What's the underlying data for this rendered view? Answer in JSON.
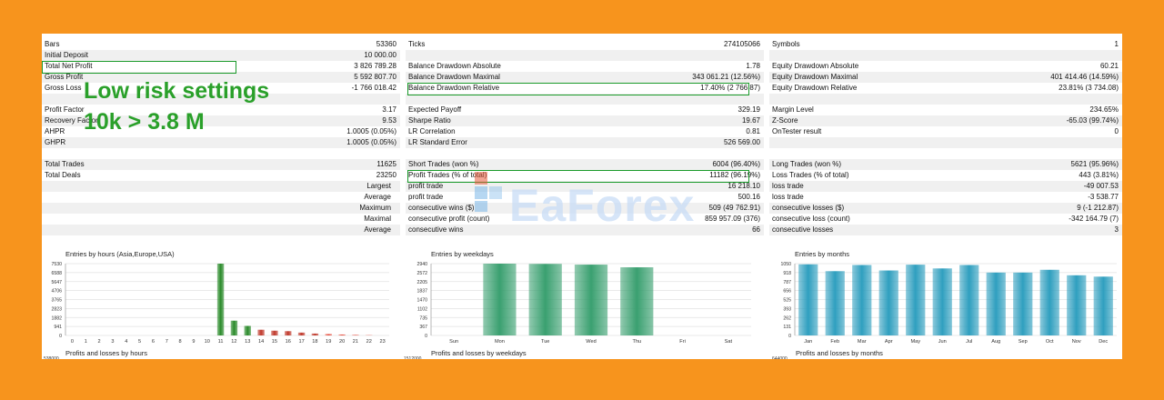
{
  "overlay": {
    "line1": "Low risk settings",
    "line2": "10k > 3.8 M"
  },
  "watermark": "EaForex",
  "col1": [
    {
      "label": "Bars",
      "value": "53360"
    },
    {
      "label": "Initial Deposit",
      "value": "10 000.00"
    },
    {
      "label": "Total Net Profit",
      "value": "3 826 789.28"
    },
    {
      "label": "Gross Profit",
      "value": "5 592 807.70"
    },
    {
      "label": "Gross Loss",
      "value": "-1 766 018.42"
    },
    {
      "label": "",
      "value": ""
    },
    {
      "label": "Profit Factor",
      "value": "3.17"
    },
    {
      "label": "Recovery Factor",
      "value": "9.53"
    },
    {
      "label": "AHPR",
      "value": "1.0005 (0.05%)"
    },
    {
      "label": "GHPR",
      "value": "1.0005 (0.05%)"
    },
    {
      "label": "",
      "value": ""
    },
    {
      "label": "Total Trades",
      "value": "11625"
    },
    {
      "label": "Total Deals",
      "value": "23250"
    },
    {
      "label": "Largest",
      "value": "",
      "right": true
    },
    {
      "label": "Average",
      "value": "",
      "right": true
    },
    {
      "label": "Maximum",
      "value": "",
      "right": true
    },
    {
      "label": "Maximal",
      "value": "",
      "right": true
    },
    {
      "label": "Average",
      "value": "",
      "right": true
    }
  ],
  "col2": [
    {
      "label": "Ticks",
      "value": "274105066"
    },
    {
      "label": "",
      "value": ""
    },
    {
      "label": "Balance Drawdown Absolute",
      "value": "1.78"
    },
    {
      "label": "Balance Drawdown Maximal",
      "value": "343 061.21 (12.56%)"
    },
    {
      "label": "Balance Drawdown Relative",
      "value": "17.40% (2 766.87)"
    },
    {
      "label": "",
      "value": ""
    },
    {
      "label": "Expected Payoff",
      "value": "329.19"
    },
    {
      "label": "Sharpe Ratio",
      "value": "19.67"
    },
    {
      "label": "LR Correlation",
      "value": "0.81"
    },
    {
      "label": "LR Standard Error",
      "value": "526 569.00"
    },
    {
      "label": "",
      "value": ""
    },
    {
      "label": "Short Trades (won %)",
      "value": "6004 (96.40%)"
    },
    {
      "label": "Profit Trades (% of total)",
      "value": "11182 (96.19%)"
    },
    {
      "label": "profit trade",
      "value": "16 218.10"
    },
    {
      "label": "profit trade",
      "value": "500.16"
    },
    {
      "label": "consecutive wins ($)",
      "value": "509 (49 762.91)"
    },
    {
      "label": "consecutive profit (count)",
      "value": "859 957.09 (376)"
    },
    {
      "label": "consecutive wins",
      "value": "66"
    }
  ],
  "col3": [
    {
      "label": "Symbols",
      "value": "1"
    },
    {
      "label": "",
      "value": ""
    },
    {
      "label": "Equity Drawdown Absolute",
      "value": "60.21"
    },
    {
      "label": "Equity Drawdown Maximal",
      "value": "401 414.46 (14.59%)"
    },
    {
      "label": "Equity Drawdown Relative",
      "value": "23.81% (3 734.08)"
    },
    {
      "label": "",
      "value": ""
    },
    {
      "label": "Margin Level",
      "value": "234.65%"
    },
    {
      "label": "Z-Score",
      "value": "-65.03 (99.74%)"
    },
    {
      "label": "OnTester result",
      "value": "0"
    },
    {
      "label": "",
      "value": ""
    },
    {
      "label": "",
      "value": ""
    },
    {
      "label": "Long Trades (won %)",
      "value": "5621 (95.96%)"
    },
    {
      "label": "Loss Trades (% of total)",
      "value": "443 (3.81%)"
    },
    {
      "label": "loss trade",
      "value": "-49 007.53"
    },
    {
      "label": "loss trade",
      "value": "-3 538.77"
    },
    {
      "label": "consecutive losses ($)",
      "value": "9 (-1 212.87)"
    },
    {
      "label": "consecutive loss (count)",
      "value": "-342 164.79 (7)"
    },
    {
      "label": "consecutive losses",
      "value": "3"
    }
  ],
  "chart_data": [
    {
      "type": "bar",
      "title": "Entries by hours (Asia,Europe,USA)",
      "categories": [
        "0",
        "1",
        "2",
        "3",
        "4",
        "5",
        "6",
        "7",
        "8",
        "9",
        "10",
        "11",
        "12",
        "13",
        "14",
        "15",
        "16",
        "17",
        "18",
        "19",
        "20",
        "21",
        "22",
        "23"
      ],
      "values": [
        0,
        0,
        0,
        0,
        0,
        0,
        0,
        0,
        0,
        0,
        0,
        7530,
        1550,
        1000,
        600,
        500,
        450,
        300,
        200,
        150,
        100,
        60,
        30,
        0
      ],
      "yticks": [
        "7530",
        "6588",
        "5647",
        "4706",
        "3765",
        "2823",
        "1882",
        "941",
        "0"
      ],
      "ylim": [
        0,
        7530
      ],
      "color": "#2a8a2a"
    },
    {
      "type": "bar",
      "title": "Entries by weekdays",
      "categories": [
        "Sun",
        "Mon",
        "Tue",
        "Wed",
        "Thu",
        "Fri",
        "Sat"
      ],
      "values": [
        0,
        2940,
        2930,
        2900,
        2790,
        0,
        0
      ],
      "yticks": [
        "2940",
        "2572",
        "2205",
        "1837",
        "1470",
        "1102",
        "735",
        "367",
        "0"
      ],
      "ylim": [
        0,
        2940
      ],
      "color": "#3aa070"
    },
    {
      "type": "bar",
      "title": "Entries by months",
      "categories": [
        "Jan",
        "Feb",
        "Mar",
        "Apr",
        "May",
        "Jun",
        "Jul",
        "Aug",
        "Sep",
        "Oct",
        "Nov",
        "Dec"
      ],
      "values": [
        1040,
        940,
        1030,
        950,
        1035,
        980,
        1030,
        920,
        920,
        960,
        880,
        860
      ],
      "yticks": [
        "1050",
        "918",
        "787",
        "656",
        "525",
        "393",
        "262",
        "131",
        "0"
      ],
      "ylim": [
        0,
        1050
      ],
      "color": "#2f9fbf"
    }
  ],
  "bottom_titles": [
    "Profits and losses by hours",
    "Profits and losses by weekdays",
    "Profits and losses by months"
  ],
  "bottom_ticks": [
    "538000",
    "1512000",
    "644000"
  ]
}
